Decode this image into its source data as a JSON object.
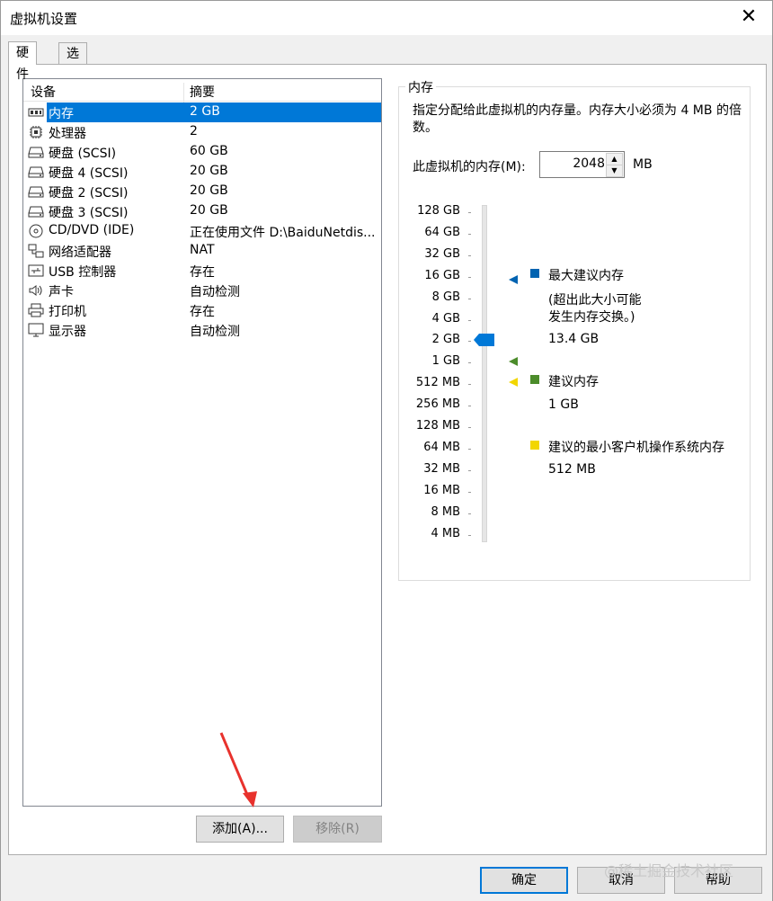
{
  "window": {
    "title": "虚拟机设置",
    "close_label": "✕"
  },
  "tabs": [
    {
      "label": "硬件",
      "active": true
    },
    {
      "label": "选项",
      "active": false
    }
  ],
  "device_list": {
    "columns": [
      "设备",
      "摘要"
    ],
    "rows": [
      {
        "icon": "memory-icon",
        "name": "内存",
        "summary": "2 GB",
        "selected": true
      },
      {
        "icon": "processor-icon",
        "name": "处理器",
        "summary": "2"
      },
      {
        "icon": "hard-disk-icon",
        "name": "硬盘 (SCSI)",
        "summary": "60 GB"
      },
      {
        "icon": "hard-disk-icon",
        "name": "硬盘 4 (SCSI)",
        "summary": "20 GB"
      },
      {
        "icon": "hard-disk-icon",
        "name": "硬盘 2 (SCSI)",
        "summary": "20 GB"
      },
      {
        "icon": "hard-disk-icon",
        "name": "硬盘 3 (SCSI)",
        "summary": "20 GB"
      },
      {
        "icon": "cd-dvd-icon",
        "name": "CD/DVD (IDE)",
        "summary": "正在使用文件 D:\\BaiduNetdis..."
      },
      {
        "icon": "network-adapter-icon",
        "name": "网络适配器",
        "summary": "NAT"
      },
      {
        "icon": "usb-icon",
        "name": "USB 控制器",
        "summary": "存在"
      },
      {
        "icon": "speaker-icon",
        "name": "声卡",
        "summary": "自动检测"
      },
      {
        "icon": "printer-icon",
        "name": "打印机",
        "summary": "存在"
      },
      {
        "icon": "monitor-icon",
        "name": "显示器",
        "summary": "自动检测"
      }
    ]
  },
  "list_buttons": {
    "add": "添加(A)...",
    "remove": "移除(R)"
  },
  "memory": {
    "group_title": "内存",
    "description": "指定分配给此虚拟机的内存量。内存大小必须为 4 MB 的倍数。",
    "field_label": "此虚拟机的内存(M):",
    "value": "2048",
    "unit": "MB",
    "scale": [
      "128 GB",
      "64 GB",
      "32 GB",
      "16 GB",
      "8 GB",
      "4 GB",
      "2 GB",
      "1 GB",
      "512 MB",
      "256 MB",
      "128 MB",
      "64 MB",
      "32 MB",
      "16 MB",
      "8 MB",
      "4 MB"
    ],
    "current_index": 6,
    "legend": {
      "max_recommended": {
        "title": "最大建议内存",
        "note_line1": "(超出此大小可能",
        "note_line2": "发生内存交换。)",
        "value": "13.4 GB",
        "color": "#0063b1"
      },
      "recommended": {
        "title": "建议内存",
        "value": "1 GB",
        "color": "#4c8c2b"
      },
      "min_guest": {
        "title": "建议的最小客户机操作系统内存",
        "value": "512 MB",
        "color": "#f2d600"
      }
    },
    "thumb_color": "#0078d7"
  },
  "dialog_buttons": {
    "ok": "确定",
    "cancel": "取消",
    "help": "帮助"
  },
  "watermark": "@稀土掘金技术社区",
  "annotation_color": "#e8322d"
}
